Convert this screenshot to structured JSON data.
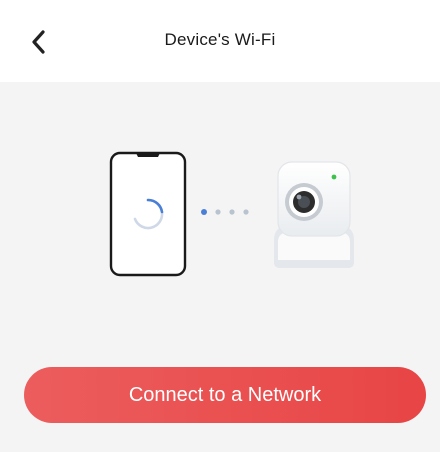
{
  "header": {
    "title": "Device's Wi-Fi",
    "back_icon": "chevron-left-icon"
  },
  "illustration": {
    "phone_icon": "smartphone-icon",
    "spinner_icon": "loading-spinner-icon",
    "dots_icon": "connecting-dots-icon",
    "camera_icon": "security-camera-icon",
    "accent_color": "#4a7fd6",
    "camera_led_color": "#3dc24a"
  },
  "actions": {
    "connect_label": "Connect to a Network",
    "button_color": "#e94b4b"
  }
}
